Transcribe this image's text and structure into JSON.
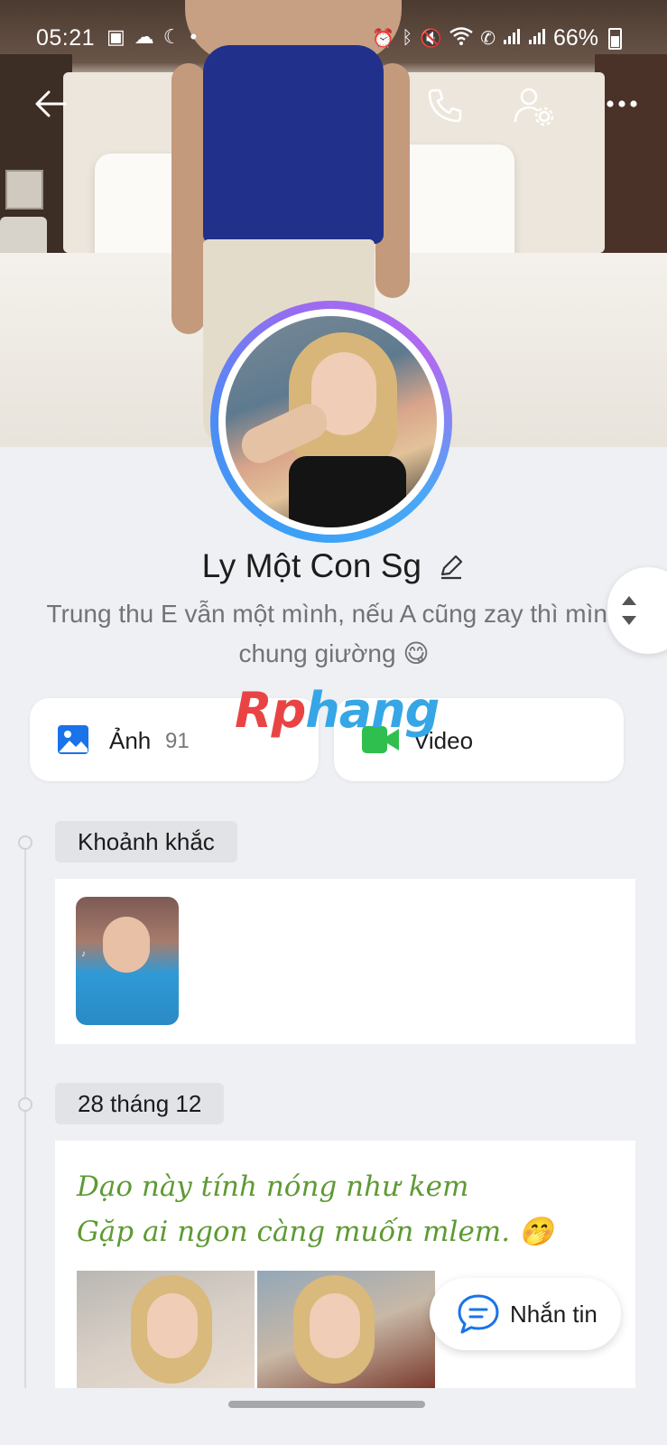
{
  "status_bar": {
    "time": "05:21",
    "battery": "66%",
    "left_icons": [
      "image-icon",
      "weather-icon",
      "moon-icon",
      "dot-icon"
    ],
    "right_icons": [
      "alarm-icon",
      "bluetooth-icon",
      "mute-icon",
      "wifi-icon",
      "wifi-call-icon",
      "signal-icon",
      "signal-icon",
      "battery-icon"
    ]
  },
  "header": {
    "icons": [
      "back-arrow-icon",
      "phone-icon",
      "user-settings-icon",
      "more-icon"
    ]
  },
  "profile": {
    "name": "Ly Một Con Sg",
    "bio": "Trung thu E vẫn một mình, nếu A cũng zay thì mình chung giường 😋"
  },
  "watermark": {
    "part1": "Rp",
    "part2": "hang"
  },
  "media_cards": {
    "photos": {
      "label": "Ảnh",
      "count": "91",
      "icon": "photo-icon",
      "icon_color": "#1a73e8"
    },
    "videos": {
      "label": "Video",
      "icon": "video-icon",
      "icon_color": "#2fbf4f"
    }
  },
  "timeline": [
    {
      "tag": "Khoảnh khắc"
    },
    {
      "tag": "28 tháng 12",
      "post_lines": [
        "Dạo này tính nóng như kem",
        "Gặp ai ngon càng muốn mlem. 🤭"
      ]
    }
  ],
  "fab": {
    "label": "Nhắn tin",
    "icon": "chat-bubble-icon"
  }
}
